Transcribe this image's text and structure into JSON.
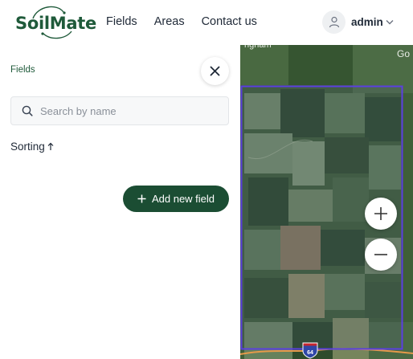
{
  "app": {
    "logo_text": "SoilMate"
  },
  "nav": {
    "items": [
      {
        "label": "Fields"
      },
      {
        "label": "Areas"
      },
      {
        "label": "Contact us"
      }
    ]
  },
  "user": {
    "name": "admin",
    "icon": "user-icon"
  },
  "panel": {
    "title": "Fields",
    "search": {
      "placeholder": "Search by name",
      "value": ""
    },
    "sorting_label": "Sorting",
    "sort_direction": "ascending",
    "add_button_label": "Add new field"
  },
  "map": {
    "labels": {
      "top_left": "ngham",
      "top_right": "Go"
    },
    "highway_shield": "64",
    "zoom": {
      "in_icon": "plus-icon",
      "out_icon": "minus-icon"
    }
  },
  "colors": {
    "brand": "#1b4d33",
    "brand_text": "#1f5a3a",
    "area_outline": "#5b3fe0"
  }
}
